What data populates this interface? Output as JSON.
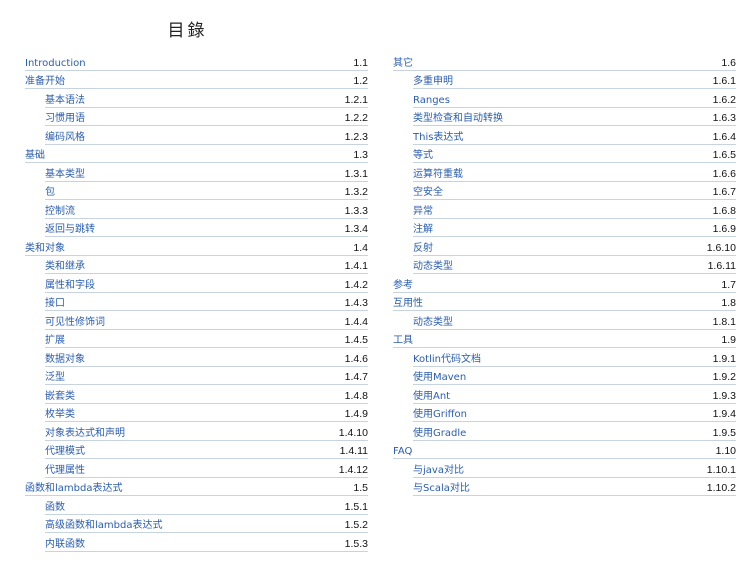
{
  "title": "目錄",
  "left": [
    {
      "label": "Introduction",
      "num": "1.1",
      "level": 1
    },
    {
      "label": "准备开始",
      "num": "1.2",
      "level": 1
    },
    {
      "label": "基本语法",
      "num": "1.2.1",
      "level": 2
    },
    {
      "label": "习惯用语",
      "num": "1.2.2",
      "level": 2
    },
    {
      "label": "编码风格",
      "num": "1.2.3",
      "level": 2
    },
    {
      "label": "基础",
      "num": "1.3",
      "level": 1
    },
    {
      "label": "基本类型",
      "num": "1.3.1",
      "level": 2
    },
    {
      "label": "包",
      "num": "1.3.2",
      "level": 2
    },
    {
      "label": "控制流",
      "num": "1.3.3",
      "level": 2
    },
    {
      "label": "返回与跳转",
      "num": "1.3.4",
      "level": 2
    },
    {
      "label": "类和对象",
      "num": "1.4",
      "level": 1
    },
    {
      "label": "类和继承",
      "num": "1.4.1",
      "level": 2
    },
    {
      "label": "属性和字段",
      "num": "1.4.2",
      "level": 2
    },
    {
      "label": "接口",
      "num": "1.4.3",
      "level": 2
    },
    {
      "label": "可见性修饰词",
      "num": "1.4.4",
      "level": 2
    },
    {
      "label": "扩展",
      "num": "1.4.5",
      "level": 2
    },
    {
      "label": "数据对象",
      "num": "1.4.6",
      "level": 2
    },
    {
      "label": "泛型",
      "num": "1.4.7",
      "level": 2
    },
    {
      "label": "嵌套类",
      "num": "1.4.8",
      "level": 2
    },
    {
      "label": "枚举类",
      "num": "1.4.9",
      "level": 2
    },
    {
      "label": "对象表达式和声明",
      "num": "1.4.10",
      "level": 2
    },
    {
      "label": "代理模式",
      "num": "1.4.11",
      "level": 2
    },
    {
      "label": "代理属性",
      "num": "1.4.12",
      "level": 2
    },
    {
      "label": "函数和lambda表达式",
      "num": "1.5",
      "level": 1
    },
    {
      "label": "函数",
      "num": "1.5.1",
      "level": 2
    },
    {
      "label": "高级函数和lambda表达式",
      "num": "1.5.2",
      "level": 2
    },
    {
      "label": "内联函数",
      "num": "1.5.3",
      "level": 2
    }
  ],
  "right": [
    {
      "label": "其它",
      "num": "1.6",
      "level": 1
    },
    {
      "label": "多重申明",
      "num": "1.6.1",
      "level": 2
    },
    {
      "label": "Ranges",
      "num": "1.6.2",
      "level": 2
    },
    {
      "label": "类型检查和自动转换",
      "num": "1.6.3",
      "level": 2
    },
    {
      "label": "This表达式",
      "num": "1.6.4",
      "level": 2
    },
    {
      "label": "等式",
      "num": "1.6.5",
      "level": 2
    },
    {
      "label": "运算符重载",
      "num": "1.6.6",
      "level": 2
    },
    {
      "label": "空安全",
      "num": "1.6.7",
      "level": 2
    },
    {
      "label": "异常",
      "num": "1.6.8",
      "level": 2
    },
    {
      "label": "注解",
      "num": "1.6.9",
      "level": 2
    },
    {
      "label": "反射",
      "num": "1.6.10",
      "level": 2
    },
    {
      "label": "动态类型",
      "num": "1.6.11",
      "level": 2
    },
    {
      "label": "参考",
      "num": "1.7",
      "level": 1
    },
    {
      "label": "互用性",
      "num": "1.8",
      "level": 1
    },
    {
      "label": "动态类型",
      "num": "1.8.1",
      "level": 2
    },
    {
      "label": "工具",
      "num": "1.9",
      "level": 1
    },
    {
      "label": "Kotlin代码文档",
      "num": "1.9.1",
      "level": 2
    },
    {
      "label": "使用Maven",
      "num": "1.9.2",
      "level": 2
    },
    {
      "label": "使用Ant",
      "num": "1.9.3",
      "level": 2
    },
    {
      "label": "使用Griffon",
      "num": "1.9.4",
      "level": 2
    },
    {
      "label": "使用Gradle",
      "num": "1.9.5",
      "level": 2
    },
    {
      "label": "FAQ",
      "num": "1.10",
      "level": 1
    },
    {
      "label": "与java对比",
      "num": "1.10.1",
      "level": 2
    },
    {
      "label": "与Scala对比",
      "num": "1.10.2",
      "level": 2
    }
  ]
}
